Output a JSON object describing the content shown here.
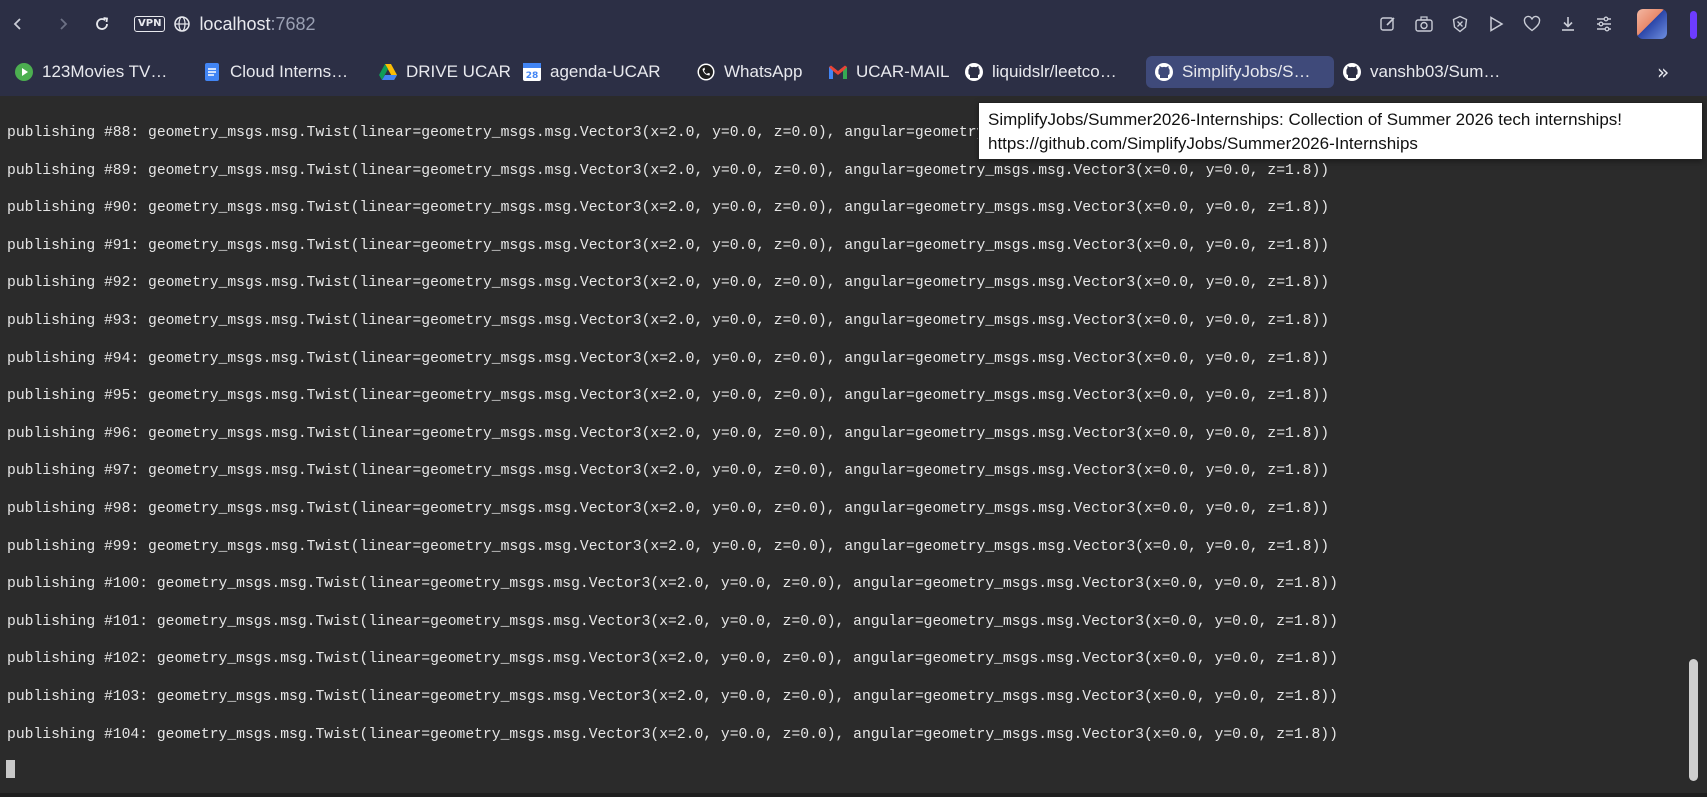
{
  "browser": {
    "url_host": "localhost",
    "url_port": ":7682",
    "vpn_label": "VPN",
    "icons": [
      "back-icon",
      "forward-icon",
      "reload-icon",
      "globe-icon",
      "edit-icon",
      "camera-icon",
      "shield-icon",
      "play-icon",
      "heart-icon",
      "download-icon",
      "menu-icon"
    ]
  },
  "bookmarks": [
    {
      "label": "123Movies TV…",
      "icon": "play-circle-icon",
      "color": "#4caf50"
    },
    {
      "label": "Cloud Interns…",
      "icon": "doc-icon",
      "color": "#4285f4"
    },
    {
      "label": "DRIVE UCAR",
      "icon": "drive-icon",
      "color": "#fbbc04"
    },
    {
      "label": "agenda-UCAR",
      "icon": "calendar-icon",
      "color": "#4285f4"
    },
    {
      "label": "WhatsApp",
      "icon": "whatsapp-icon",
      "color": "#25d366"
    },
    {
      "label": "UCAR-MAIL",
      "icon": "gmail-icon",
      "color": "#ea4335"
    },
    {
      "label": "liquidslr/leetco…",
      "icon": "github-icon",
      "color": "#ffffff"
    },
    {
      "label": "SimplifyJobs/S…",
      "icon": "github-icon",
      "color": "#ffffff",
      "active": true
    },
    {
      "label": "vanshb03/Sum…",
      "icon": "github-icon",
      "color": "#ffffff"
    }
  ],
  "bookmarks_more": "»",
  "tooltip": {
    "title": "SimplifyJobs/Summer2026-Internships: Collection of Summer 2026 tech internships!",
    "url": "https://github.com/SimplifyJobs/Summer2026-Internships"
  },
  "terminal": {
    "lines": [
      "publishing #88: geometry_msgs.msg.Twist(linear=geometry_msgs.msg.Vector3(x=2.0, y=0.0, z=0.0), angular=geometry_msgs.msg.Vector3(x=0.0, y=0.0, z=1.8))",
      "publishing #89: geometry_msgs.msg.Twist(linear=geometry_msgs.msg.Vector3(x=2.0, y=0.0, z=0.0), angular=geometry_msgs.msg.Vector3(x=0.0, y=0.0, z=1.8))",
      "publishing #90: geometry_msgs.msg.Twist(linear=geometry_msgs.msg.Vector3(x=2.0, y=0.0, z=0.0), angular=geometry_msgs.msg.Vector3(x=0.0, y=0.0, z=1.8))",
      "publishing #91: geometry_msgs.msg.Twist(linear=geometry_msgs.msg.Vector3(x=2.0, y=0.0, z=0.0), angular=geometry_msgs.msg.Vector3(x=0.0, y=0.0, z=1.8))",
      "publishing #92: geometry_msgs.msg.Twist(linear=geometry_msgs.msg.Vector3(x=2.0, y=0.0, z=0.0), angular=geometry_msgs.msg.Vector3(x=0.0, y=0.0, z=1.8))",
      "publishing #93: geometry_msgs.msg.Twist(linear=geometry_msgs.msg.Vector3(x=2.0, y=0.0, z=0.0), angular=geometry_msgs.msg.Vector3(x=0.0, y=0.0, z=1.8))",
      "publishing #94: geometry_msgs.msg.Twist(linear=geometry_msgs.msg.Vector3(x=2.0, y=0.0, z=0.0), angular=geometry_msgs.msg.Vector3(x=0.0, y=0.0, z=1.8))",
      "publishing #95: geometry_msgs.msg.Twist(linear=geometry_msgs.msg.Vector3(x=2.0, y=0.0, z=0.0), angular=geometry_msgs.msg.Vector3(x=0.0, y=0.0, z=1.8))",
      "publishing #96: geometry_msgs.msg.Twist(linear=geometry_msgs.msg.Vector3(x=2.0, y=0.0, z=0.0), angular=geometry_msgs.msg.Vector3(x=0.0, y=0.0, z=1.8))",
      "publishing #97: geometry_msgs.msg.Twist(linear=geometry_msgs.msg.Vector3(x=2.0, y=0.0, z=0.0), angular=geometry_msgs.msg.Vector3(x=0.0, y=0.0, z=1.8))",
      "publishing #98: geometry_msgs.msg.Twist(linear=geometry_msgs.msg.Vector3(x=2.0, y=0.0, z=0.0), angular=geometry_msgs.msg.Vector3(x=0.0, y=0.0, z=1.8))",
      "publishing #99: geometry_msgs.msg.Twist(linear=geometry_msgs.msg.Vector3(x=2.0, y=0.0, z=0.0), angular=geometry_msgs.msg.Vector3(x=0.0, y=0.0, z=1.8))",
      "publishing #100: geometry_msgs.msg.Twist(linear=geometry_msgs.msg.Vector3(x=2.0, y=0.0, z=0.0), angular=geometry_msgs.msg.Vector3(x=0.0, y=0.0, z=1.8))",
      "publishing #101: geometry_msgs.msg.Twist(linear=geometry_msgs.msg.Vector3(x=2.0, y=0.0, z=0.0), angular=geometry_msgs.msg.Vector3(x=0.0, y=0.0, z=1.8))",
      "publishing #102: geometry_msgs.msg.Twist(linear=geometry_msgs.msg.Vector3(x=2.0, y=0.0, z=0.0), angular=geometry_msgs.msg.Vector3(x=0.0, y=0.0, z=1.8))",
      "publishing #103: geometry_msgs.msg.Twist(linear=geometry_msgs.msg.Vector3(x=2.0, y=0.0, z=0.0), angular=geometry_msgs.msg.Vector3(x=0.0, y=0.0, z=1.8))",
      "publishing #104: geometry_msgs.msg.Twist(linear=geometry_msgs.msg.Vector3(x=2.0, y=0.0, z=0.0), angular=geometry_msgs.msg.Vector3(x=0.0, y=0.0, z=1.8))"
    ]
  }
}
